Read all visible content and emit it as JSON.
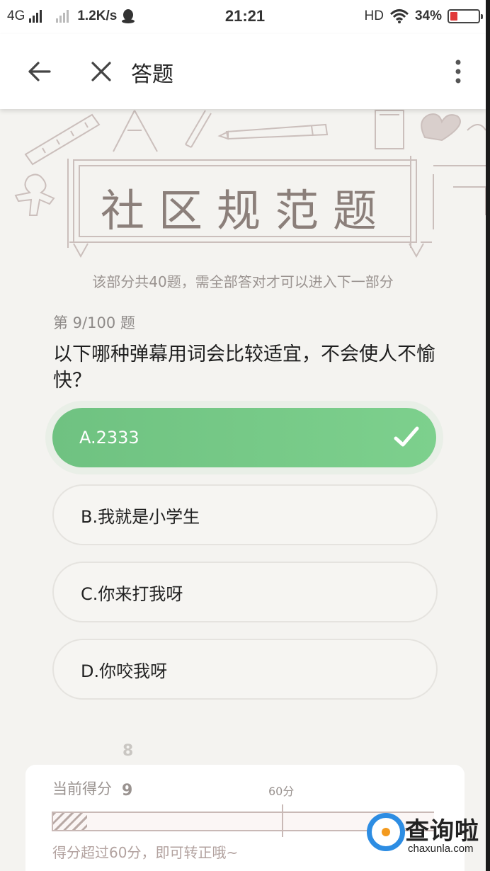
{
  "status_bar": {
    "network": "4G",
    "speed": "1.2K/s",
    "time": "21:21",
    "hd": "HD",
    "battery": "34%",
    "battery_level": 0.34,
    "battery_color": "#e03a3a"
  },
  "app_bar": {
    "title": "答题",
    "back_icon": "arrow-left-icon",
    "close_icon": "close-icon",
    "more_icon": "more-vertical-icon"
  },
  "banner": {
    "title": "社区规范题",
    "subtitle": "该部分共40题，需全部答对才可以进入下一部分"
  },
  "quiz": {
    "progress": "第 9/100 题",
    "question": "以下哪种弹幕用词会比较适宜，不会使人不愉快？",
    "options": [
      {
        "label": "A.2333",
        "selected": true
      },
      {
        "label": "B.我就是小学生",
        "selected": false
      },
      {
        "label": "C.你来打我呀",
        "selected": false
      },
      {
        "label": "D.你咬我呀",
        "selected": false
      }
    ],
    "selected_color": "#6fc281"
  },
  "score": {
    "label": "当前得分",
    "value": "9",
    "prev_value": "8",
    "threshold_label": "60分",
    "progress_fraction": 0.09,
    "hint": "得分超过60分，即可转正哦~"
  },
  "watermark": {
    "name": "查询啦",
    "domain": "chaxunla.com"
  }
}
